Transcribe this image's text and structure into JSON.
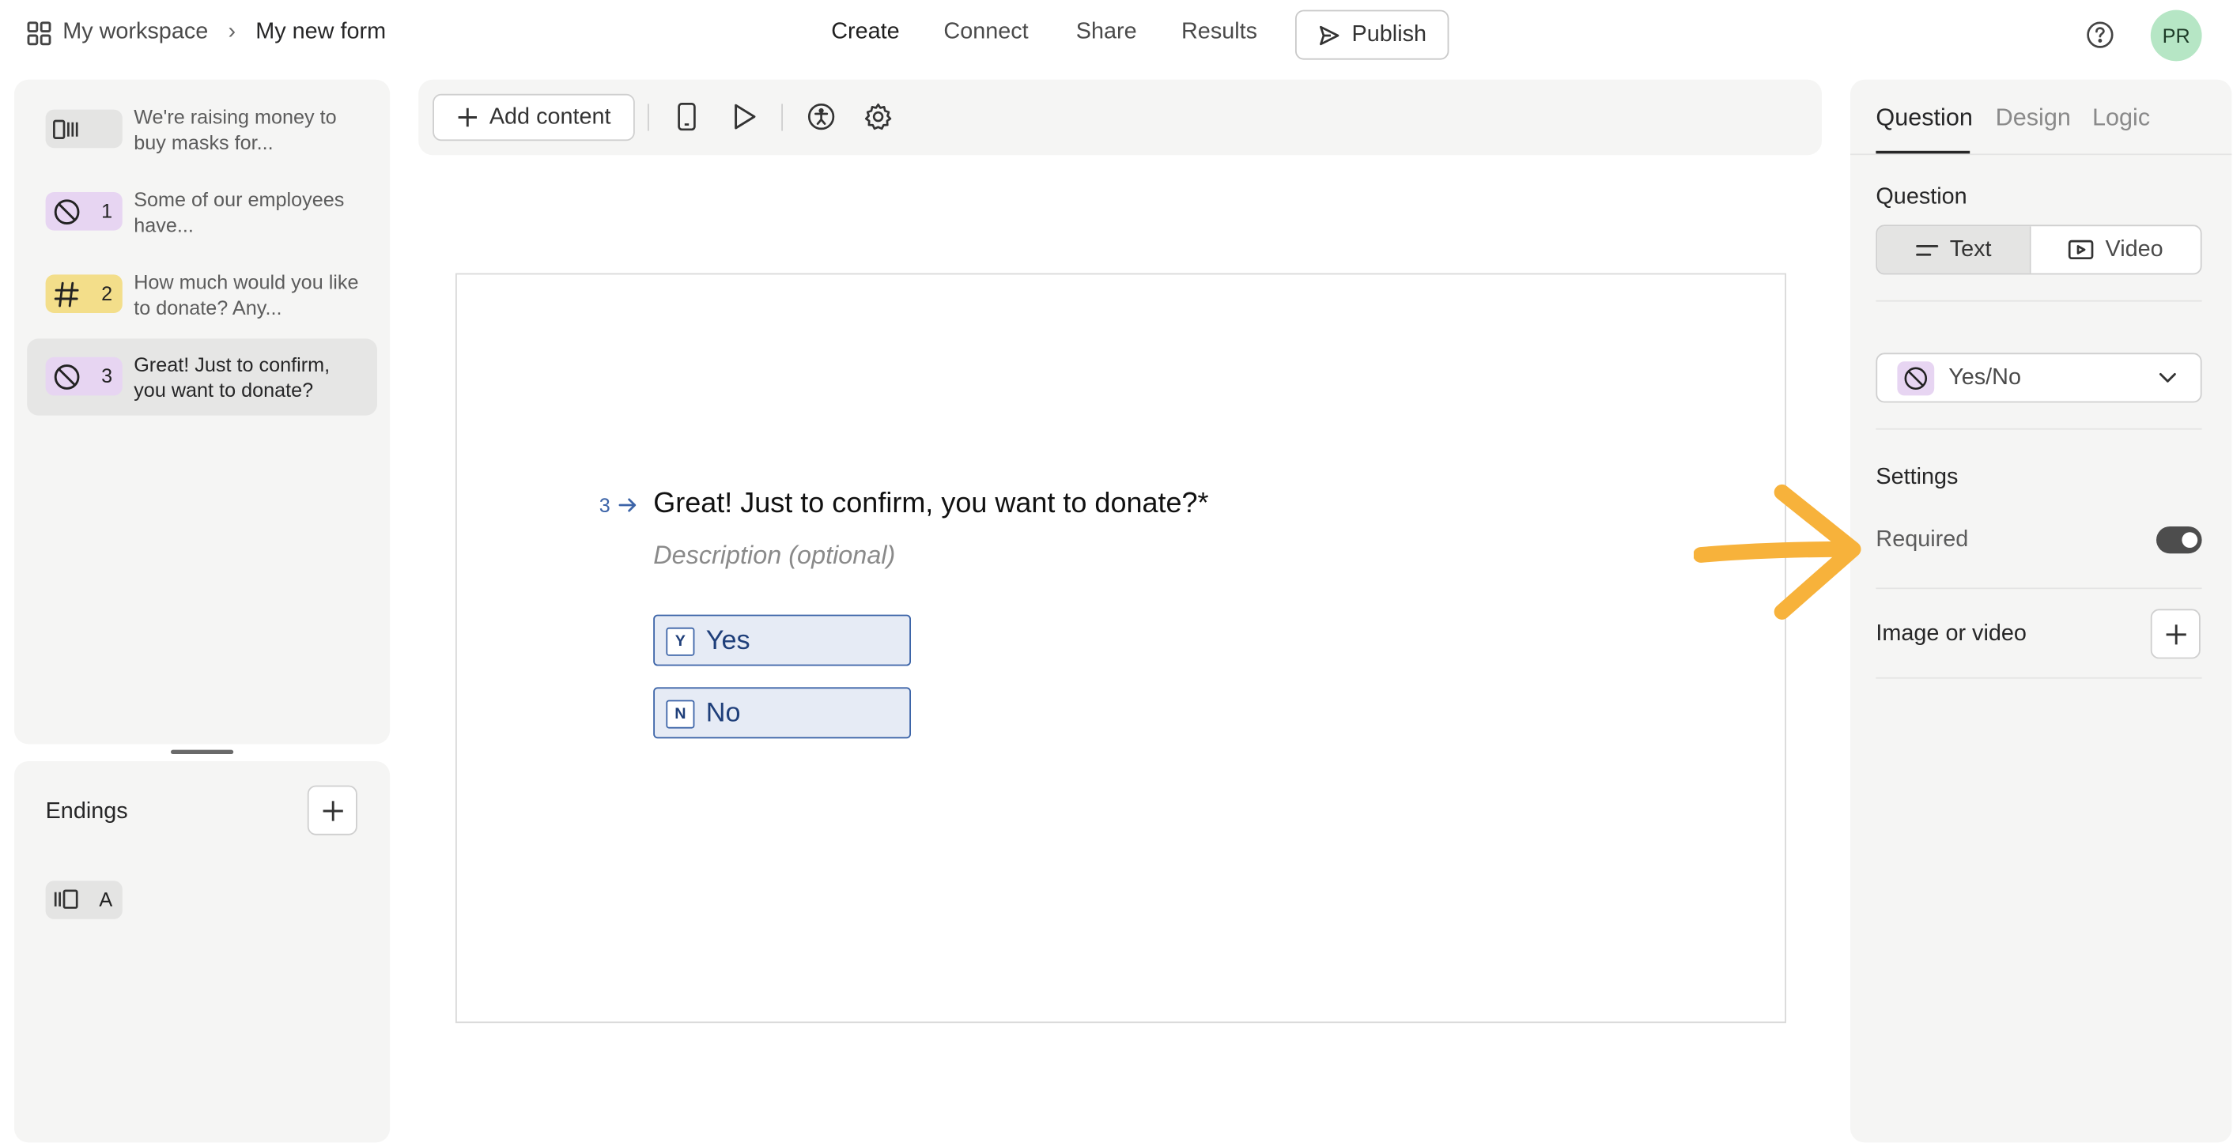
{
  "header": {
    "breadcrumb_workspace": "My workspace",
    "breadcrumb_separator": "›",
    "breadcrumb_form": "My new form",
    "nav": {
      "create": "Create",
      "connect": "Connect",
      "share": "Share",
      "results": "Results"
    },
    "publish_label": "Publish",
    "avatar_initials": "PR",
    "help_icon": "help-circle-icon"
  },
  "sidebar": {
    "questions": [
      {
        "badge": "",
        "text": "We're raising money to buy masks for...",
        "icon": "statement-icon",
        "badge_color": "#e4e4e3"
      },
      {
        "badge": "1",
        "text": "Some of our employees have...",
        "icon": "yes-no-icon",
        "badge_color": "#e7d5f2"
      },
      {
        "badge": "2",
        "text": "How much would you like to donate? Any...",
        "icon": "hash-icon",
        "badge_color": "#f3de8a"
      },
      {
        "badge": "3",
        "text": "Great! Just to confirm, you want to donate?",
        "icon": "yes-no-icon",
        "badge_color": "#e7d5f2"
      }
    ],
    "endings_title": "Endings",
    "endings": [
      {
        "badge": "A",
        "icon": "ending-icon",
        "badge_color": "#e4e4e3"
      }
    ]
  },
  "toolbar": {
    "add_content_label": "Add content",
    "icons": [
      "mobile-preview-icon",
      "play-icon",
      "accessibility-icon",
      "settings-gear-icon"
    ]
  },
  "canvas": {
    "question_number": "3",
    "question_text": "Great! Just to confirm, you want to donate?*",
    "description_placeholder": "Description (optional)",
    "choices": [
      {
        "key": "Y",
        "label": "Yes"
      },
      {
        "key": "N",
        "label": "No"
      }
    ]
  },
  "right_panel": {
    "tabs": {
      "question": "Question",
      "design": "Design",
      "logic": "Logic"
    },
    "question_section_title": "Question",
    "segment": {
      "text_label": "Text",
      "video_label": "Video"
    },
    "question_type": "Yes/No",
    "settings_title": "Settings",
    "required_label": "Required",
    "required_on": true,
    "image_video_label": "Image or video"
  },
  "annotation": {
    "arrow_color": "#f7b23b"
  },
  "colors": {
    "accent_blue": "#3c64a8",
    "yes_no_badge": "#e7d5f2",
    "number_badge": "#f3de8a",
    "avatar_bg": "#b6e6c5"
  }
}
